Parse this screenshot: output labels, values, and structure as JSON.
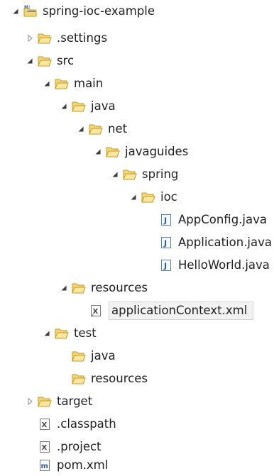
{
  "tree": {
    "project": "spring-ioc-example",
    "settings": ".settings",
    "src": "src",
    "main": "main",
    "main_java": "java",
    "net": "net",
    "javaguides": "javaguides",
    "spring": "spring",
    "ioc": "ioc",
    "appconfig": "AppConfig.java",
    "application": "Application.java",
    "helloworld": "HelloWorld.java",
    "resources": "resources",
    "appcontext": "applicationContext.xml",
    "test": "test",
    "test_java": "java",
    "test_resources": "resources",
    "target": "target",
    "classpath": ".classpath",
    "project_file": ".project",
    "pom": "pom.xml"
  },
  "colors": {
    "folder_fill": "#f7d774",
    "folder_edge": "#c89a1c",
    "java_blue": "#2d5fa8",
    "xml_gray": "#6e6e6e"
  }
}
